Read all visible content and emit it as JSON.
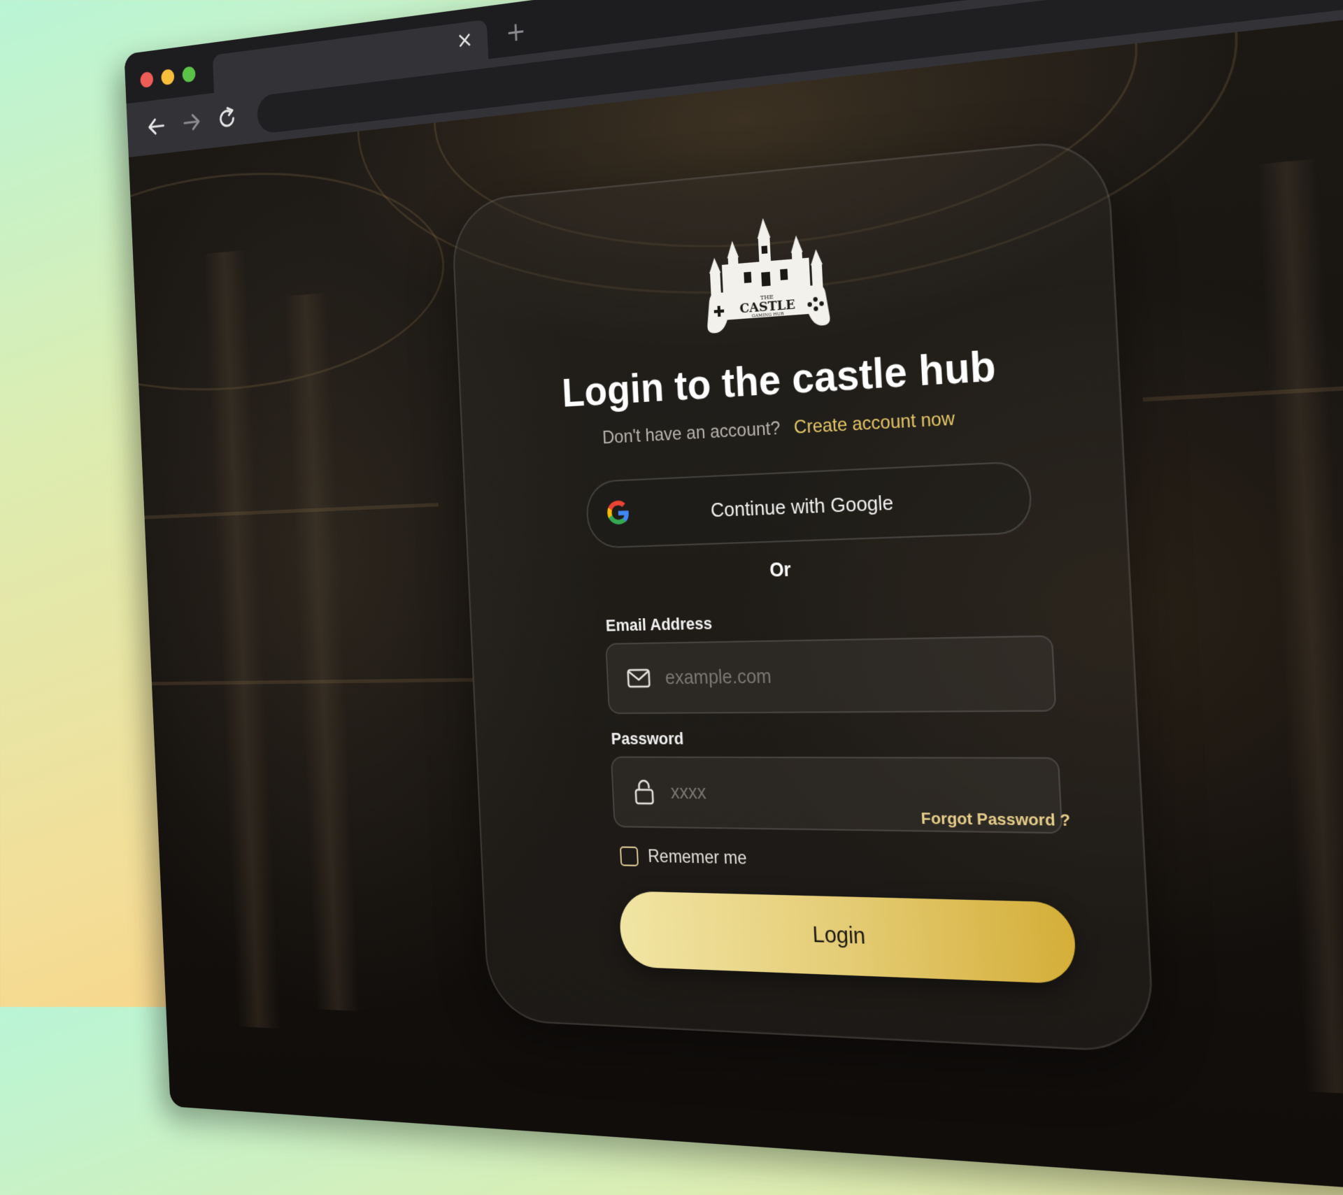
{
  "browser": {
    "tab": {
      "title": "",
      "close_icon": "close-icon",
      "close_glyph": "×"
    },
    "new_tab_glyph": "+",
    "address_bar": {
      "value": ""
    }
  },
  "login": {
    "logo": {
      "name": "castle-gaming-hub-logo",
      "line1": "THE",
      "line2": "CASTLE",
      "line3": "GAMING HUB"
    },
    "title": "Login to the castle hub",
    "no_account_text": "Don't have an account?",
    "create_account_link": "Create account now",
    "google_button_label": "Continue with Google",
    "divider_text": "Or",
    "email": {
      "label": "Email Address",
      "placeholder": "example.com",
      "value": "",
      "icon": "mail-icon"
    },
    "password": {
      "label": "Password",
      "placeholder": "xxxx",
      "value": "",
      "icon": "lock-icon"
    },
    "forgot_password_link": "Forgot Password ?",
    "remember_me_label": "Rememer me",
    "remember_me_checked": false,
    "login_button_label": "Login"
  },
  "colors": {
    "accent_gold": "#e6c86a",
    "login_gradient_start": "#f1e5a4",
    "login_gradient_end": "#d4ae38",
    "card_border": "rgba(255,255,255,0.12)"
  }
}
